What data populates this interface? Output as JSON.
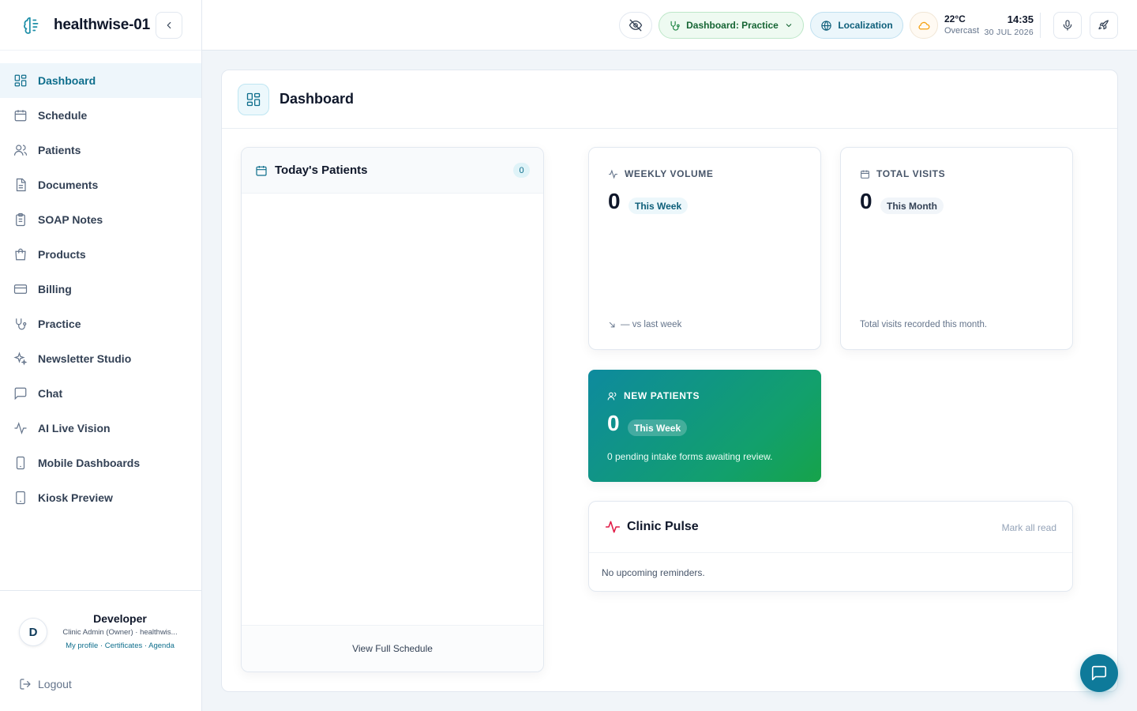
{
  "app": {
    "name": "healthwise-01"
  },
  "sidebar": {
    "items": [
      {
        "label": "Dashboard",
        "icon": "dashboard-grid-icon"
      },
      {
        "label": "Schedule",
        "icon": "calendar-icon"
      },
      {
        "label": "Patients",
        "icon": "users-icon"
      },
      {
        "label": "Documents",
        "icon": "document-icon"
      },
      {
        "label": "SOAP Notes",
        "icon": "clipboard-icon"
      },
      {
        "label": "Products",
        "icon": "shopping-bag-icon"
      },
      {
        "label": "Billing",
        "icon": "credit-card-icon"
      },
      {
        "label": "Practice",
        "icon": "stethoscope-icon"
      },
      {
        "label": "Newsletter Studio",
        "icon": "sparkles-icon"
      },
      {
        "label": "Chat",
        "icon": "message-square-icon"
      },
      {
        "label": "AI Live Vision",
        "icon": "activity-icon"
      },
      {
        "label": "Mobile Dashboards",
        "icon": "smartphone-icon"
      },
      {
        "label": "Kiosk Preview",
        "icon": "tablet-icon"
      }
    ],
    "user": {
      "initial": "D",
      "name": "Developer",
      "role": "Clinic Admin (Owner) · healthwis...",
      "links": "My profile · Certificates · Agenda"
    },
    "logout": "Logout"
  },
  "topbar": {
    "practice_pill": "Dashboard: Practice",
    "localization": "Localization",
    "weather": {
      "temp": "22°C",
      "condition": "Overcast"
    },
    "time": "14:35",
    "date": "30 JUL 2026"
  },
  "page": {
    "title": "Dashboard"
  },
  "today": {
    "title": "Today's Patients",
    "count": "0",
    "footer": "View Full Schedule"
  },
  "weekly": {
    "label": "WEEKLY VOLUME",
    "value": "0",
    "pill": "This Week",
    "footer": "— vs last week"
  },
  "total": {
    "label": "TOTAL VISITS",
    "value": "0",
    "pill": "This Month",
    "footer": "Total visits recorded this month."
  },
  "new_patients": {
    "label": "NEW PATIENTS",
    "value": "0",
    "pill": "This Week",
    "sub": "0 pending intake forms awaiting review."
  },
  "pulse": {
    "title": "Clinic Pulse",
    "action": "Mark all read",
    "empty": "No upcoming reminders."
  },
  "colors": {
    "accent": "#0e6e8c",
    "gradient_start": "#0e8a9e",
    "gradient_end": "#16a34a",
    "pulse_icon": "#e11d48"
  }
}
